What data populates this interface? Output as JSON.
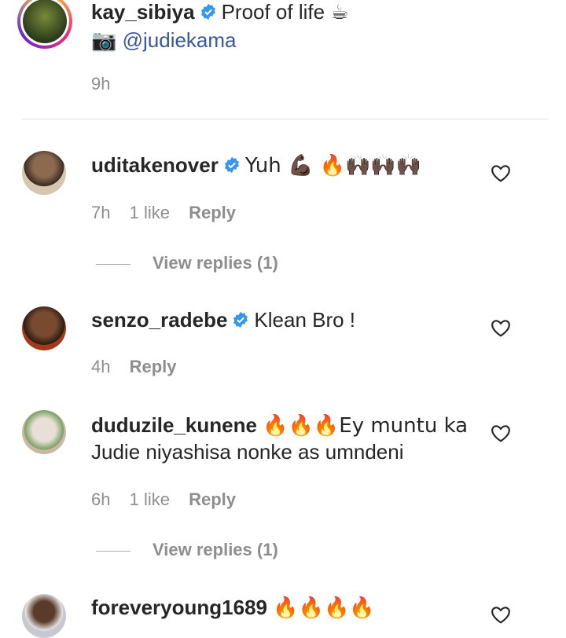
{
  "caption": {
    "username": "kay_sibiya",
    "text": "Proof of life",
    "text_emoji": "☕",
    "camera_emoji": "📷",
    "mention": "@judiekama",
    "time": "9h"
  },
  "comments": [
    {
      "username": "uditakenover",
      "verified": true,
      "text": "Yuh 💪🏿 🔥🙌🏿🙌🏿🙌🏿",
      "time": "7h",
      "likes": "1 like",
      "reply": "Reply",
      "view_replies": "View replies (1)"
    },
    {
      "username": "senzo_radebe",
      "verified": true,
      "text": "Klean Bro !",
      "time": "4h",
      "reply": "Reply"
    },
    {
      "username": "duduzile_kunene",
      "verified": false,
      "text_line1": "🔥🔥🔥Ey muntu ka",
      "text_line2": "Judie niyashisa nonke as umndeni",
      "time": "6h",
      "likes": "1 like",
      "reply": "Reply",
      "view_replies": "View replies (1)"
    },
    {
      "username": "foreveryoung1689",
      "verified": false,
      "text": "🔥🔥🔥🔥"
    }
  ],
  "colors": {
    "text": "#262626",
    "meta": "#8e8e8e",
    "verified": "#3797f0",
    "mention": "#385898"
  }
}
